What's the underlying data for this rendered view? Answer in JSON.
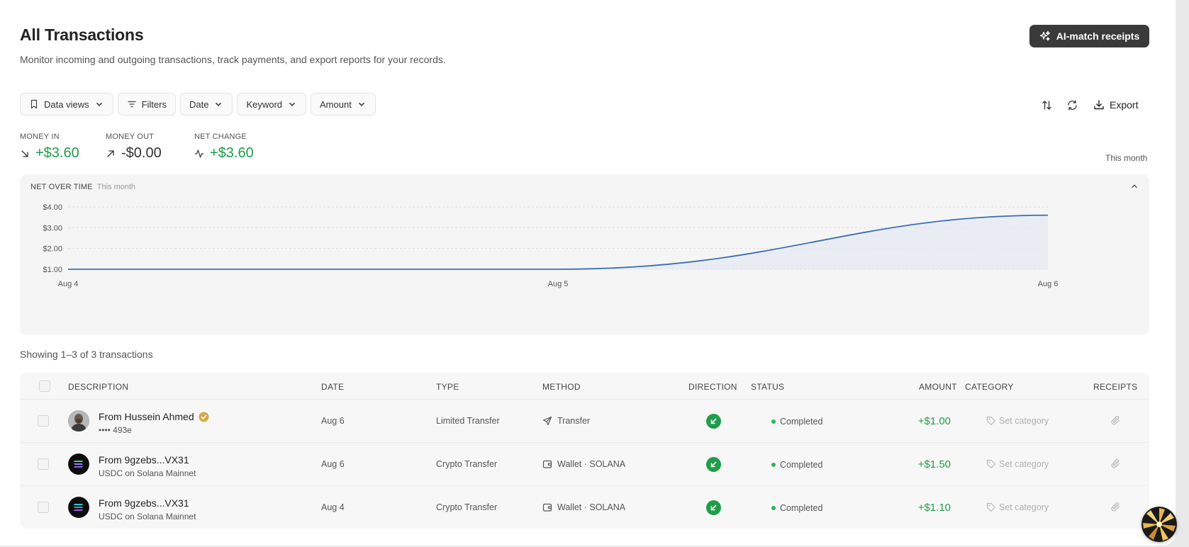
{
  "header": {
    "title": "All Transactions",
    "subtitle": "Monitor incoming and outgoing transactions, track payments, and export reports for your records.",
    "ai_button_label": "AI-match receipts"
  },
  "filters": {
    "data_views": "Data views",
    "filters": "Filters",
    "date": "Date",
    "keyword": "Keyword",
    "amount": "Amount"
  },
  "toolbar": {
    "sort_icon": "sort-arrows-icon",
    "refresh_icon": "refresh-icon",
    "export_label": "Export"
  },
  "stats": {
    "money_in_label": "MONEY IN",
    "money_in_value": "+$3.60",
    "money_out_label": "MONEY OUT",
    "money_out_value": "-$0.00",
    "net_change_label": "NET CHANGE",
    "net_change_value": "+$3.60",
    "period": "This month"
  },
  "chart": {
    "heading": "NET OVER TIME",
    "period": "This month"
  },
  "chart_data": {
    "type": "area",
    "title": "NET OVER TIME",
    "subtitle": "This month",
    "x": [
      "Aug 4",
      "Aug 5",
      "Aug 6"
    ],
    "series": [
      {
        "values": [
          1.0,
          1.0,
          3.6
        ]
      }
    ],
    "y_ticks": [
      "$1.00",
      "$2.00",
      "$3.00",
      "$4.00"
    ],
    "ylim": [
      1,
      4
    ],
    "grid": true,
    "line_color": "#3b6fb6",
    "fill_color": "#e6ebf3"
  },
  "table": {
    "showing": "Showing 1–3 of 3 transactions",
    "columns": [
      "DESCRIPTION",
      "DATE",
      "TYPE",
      "METHOD",
      "DIRECTION",
      "STATUS",
      "AMOUNT",
      "CATEGORY",
      "RECEIPTS"
    ],
    "rows": [
      {
        "title": "From Hussein Ahmed",
        "verified": true,
        "subtitle": "•••• 493e",
        "avatar": "person-avatar",
        "date": "Aug 6",
        "type": "Limited Transfer",
        "method_icon": "send-icon",
        "method": "Transfer",
        "direction": "incoming",
        "status": "Completed",
        "amount": "+$1.00",
        "category": "Set category"
      },
      {
        "title": "From 9gzebs...VX31",
        "verified": false,
        "subtitle": "USDC on Solana Mainnet",
        "avatar": "solana-logo",
        "date": "Aug 6",
        "type": "Crypto Transfer",
        "method_icon": "wallet-icon",
        "method": "Wallet · SOLANA",
        "direction": "incoming",
        "status": "Completed",
        "amount": "+$1.50",
        "category": "Set category"
      },
      {
        "title": "From 9gzebs...VX31",
        "verified": false,
        "subtitle": "USDC on Solana Mainnet",
        "avatar": "solana-logo",
        "date": "Aug 4",
        "type": "Crypto Transfer",
        "method_icon": "wallet-icon",
        "method": "Wallet · SOLANA",
        "direction": "incoming",
        "status": "Completed",
        "amount": "+$1.10",
        "category": "Set category"
      }
    ]
  },
  "colors": {
    "accent_dark": "#3a3a3a",
    "positive": "#1f9d49",
    "status_dot": "#2fb35d"
  }
}
